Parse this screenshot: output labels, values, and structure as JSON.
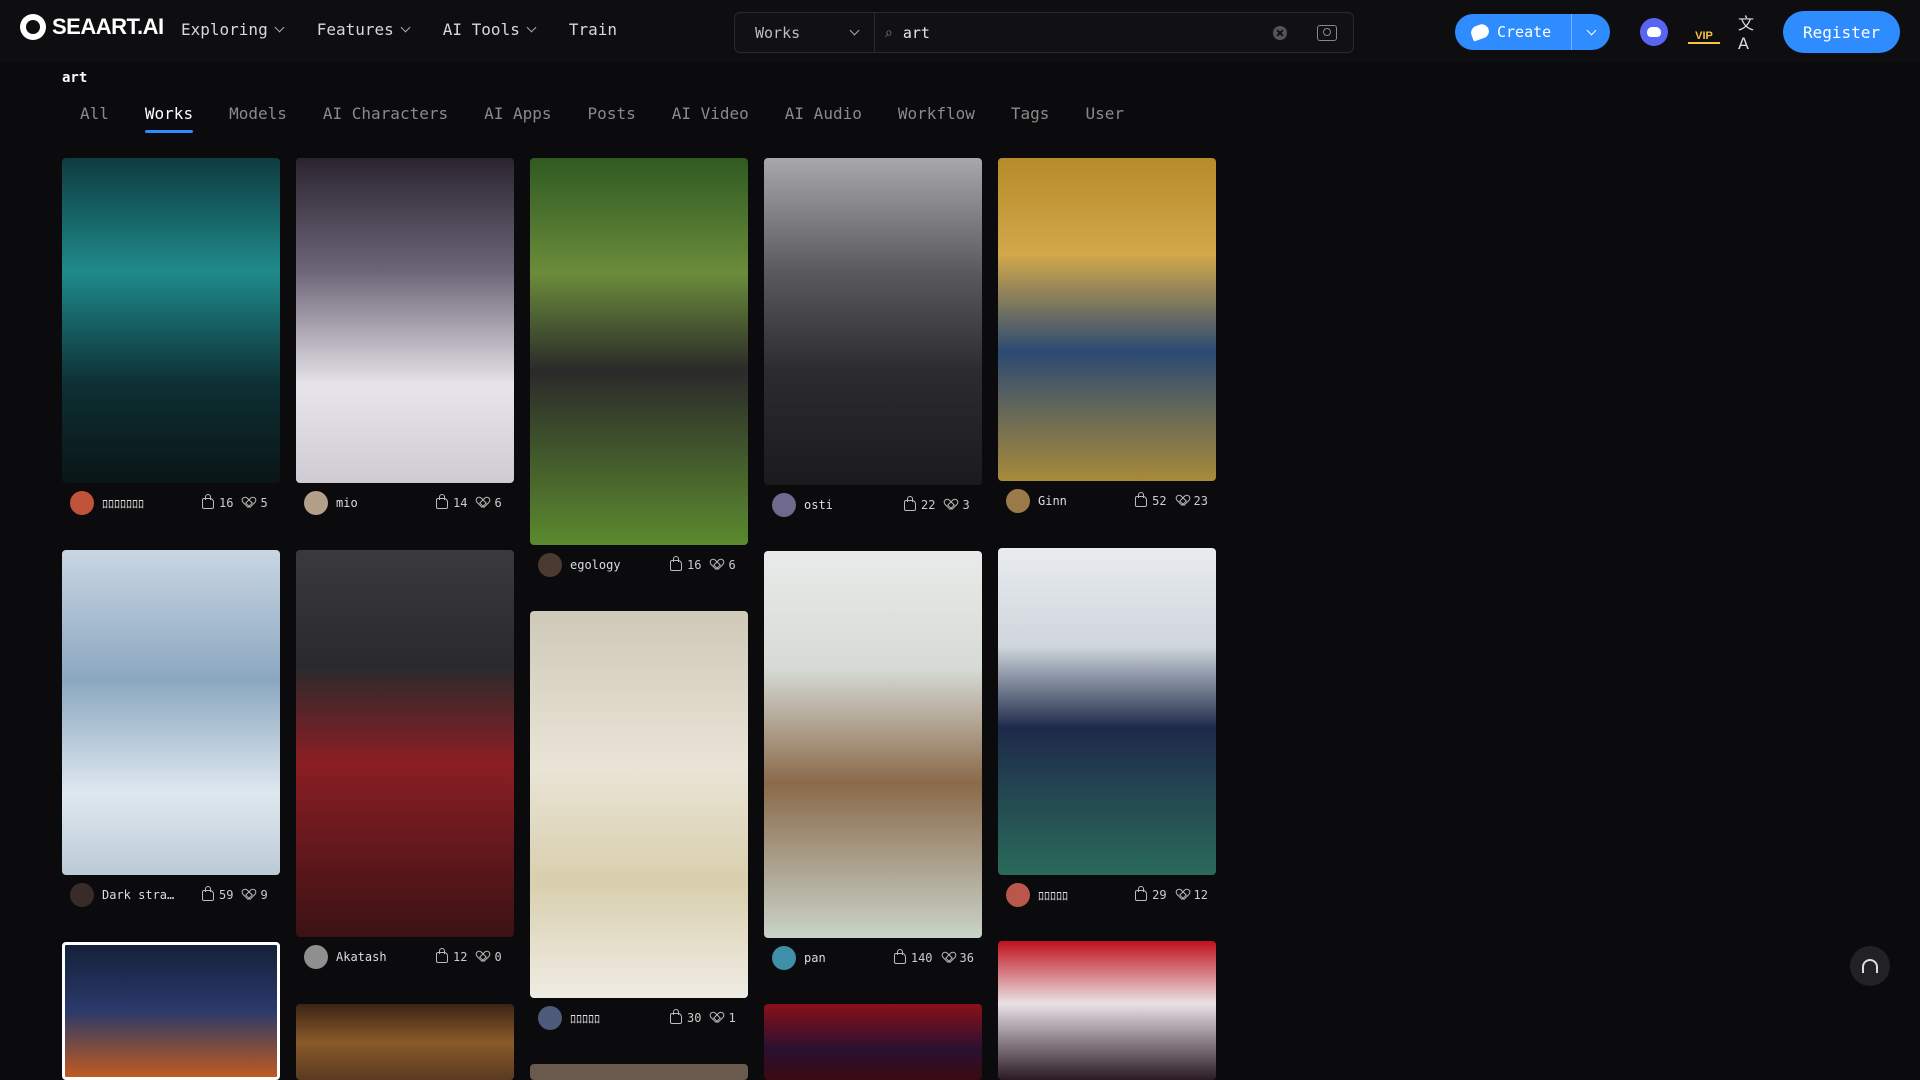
{
  "header": {
    "logo": "SEAART.AI",
    "nav": [
      "Exploring",
      "Features",
      "AI Tools",
      "Train"
    ],
    "search": {
      "type": "Works",
      "value": "art"
    },
    "create_label": "Create",
    "vip_label": "VIP",
    "translate_label": "文A",
    "register_label": "Register"
  },
  "query": "art",
  "tabs": [
    "All",
    "Works",
    "Models",
    "AI Characters",
    "AI Apps",
    "Posts",
    "AI Video",
    "AI Audio",
    "Workflow",
    "Tags",
    "User"
  ],
  "active_tab": "Works",
  "cards": [
    {
      "author": "ﾛﾛﾛﾛﾛﾛﾛ",
      "likes": "16",
      "favorites": "5"
    },
    {
      "author": "mio",
      "likes": "14",
      "favorites": "6"
    },
    {
      "author": "egology",
      "likes": "16",
      "favorites": "6"
    },
    {
      "author": "osti",
      "likes": "22",
      "favorites": "3"
    },
    {
      "author": "Ginn",
      "likes": "52",
      "favorites": "23"
    },
    {
      "author": "Dark stra…",
      "likes": "59",
      "favorites": "9"
    },
    {
      "author": "Akatash",
      "likes": "12",
      "favorites": "0"
    },
    {
      "author": "ﾛﾛﾛﾛﾛ",
      "likes": "30",
      "favorites": "1"
    },
    {
      "author": "pan",
      "likes": "140",
      "favorites": "36"
    },
    {
      "author": "ﾛﾛﾛﾛﾛ",
      "likes": "29",
      "favorites": "12"
    },
    {
      "author": "",
      "likes": "",
      "favorites": ""
    },
    {
      "author": "",
      "likes": "",
      "favorites": ""
    },
    {
      "author": "",
      "likes": "",
      "favorites": ""
    },
    {
      "author": "",
      "likes": "",
      "favorites": ""
    },
    {
      "author": "",
      "likes": "",
      "favorites": ""
    }
  ]
}
